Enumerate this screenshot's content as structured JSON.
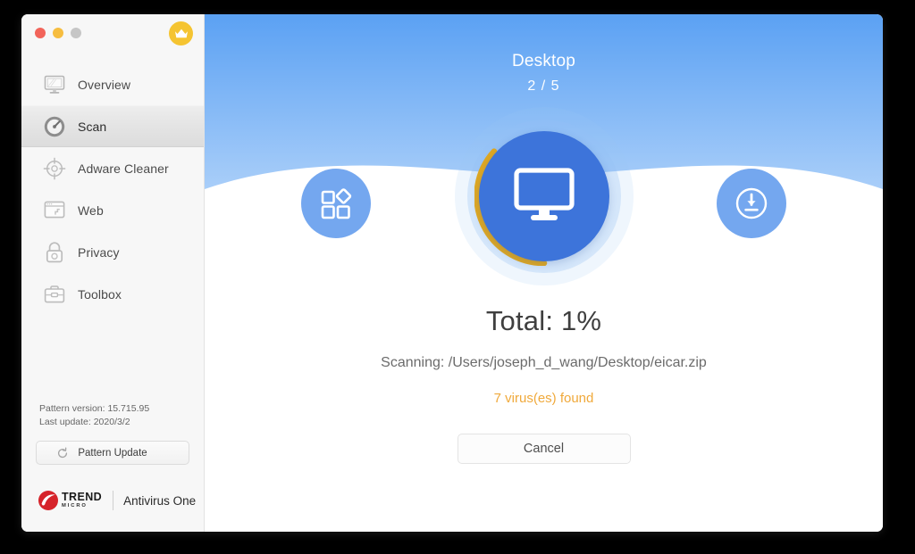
{
  "window": {
    "traffic_lights": [
      "close",
      "minimize",
      "zoom"
    ],
    "premium_badge_icon": "crown-icon"
  },
  "sidebar": {
    "items": [
      {
        "label": "Overview",
        "icon": "monitor-icon",
        "active": false
      },
      {
        "label": "Scan",
        "icon": "gauge-icon",
        "active": true
      },
      {
        "label": "Adware Cleaner",
        "icon": "crosshair-icon",
        "active": false
      },
      {
        "label": "Web",
        "icon": "browser-icon",
        "active": false
      },
      {
        "label": "Privacy",
        "icon": "lock-icon",
        "active": false
      },
      {
        "label": "Toolbox",
        "icon": "briefcase-icon",
        "active": false
      }
    ],
    "pattern_version_line": "Pattern version: 15.715.95",
    "last_update_line": "Last update: 2020/3/2",
    "pattern_update_button": "Pattern Update",
    "pattern_update_icon": "refresh-icon",
    "brand": {
      "logo_icon": "trend-micro-logo-icon",
      "name_line1": "TREND",
      "name_line2": "MICRO",
      "product": "Antivirus One"
    }
  },
  "main": {
    "scan_target": "Desktop",
    "scan_step": "2 / 5",
    "left_bubble_icon": "apps-grid-icon",
    "center_icon": "desktop-monitor-icon",
    "right_bubble_icon": "download-circle-icon",
    "total_label": "Total: 1%",
    "scanning_label": "Scanning: /Users/joseph_d_wang/Desktop/eicar.zip",
    "virus_found_label": "7 virus(es) found",
    "cancel_button": "Cancel",
    "progress_percent": 1,
    "colors": {
      "sky_top": "#5ba1f3",
      "sky_bottom": "#a9cef9",
      "core_blue": "#3d74da",
      "bubble_blue": "#74a7ef",
      "progress_gold": "#e0a821",
      "virus_orange": "#f0a93b",
      "crown_gold": "#f5c431",
      "brand_red": "#d6232a"
    }
  }
}
